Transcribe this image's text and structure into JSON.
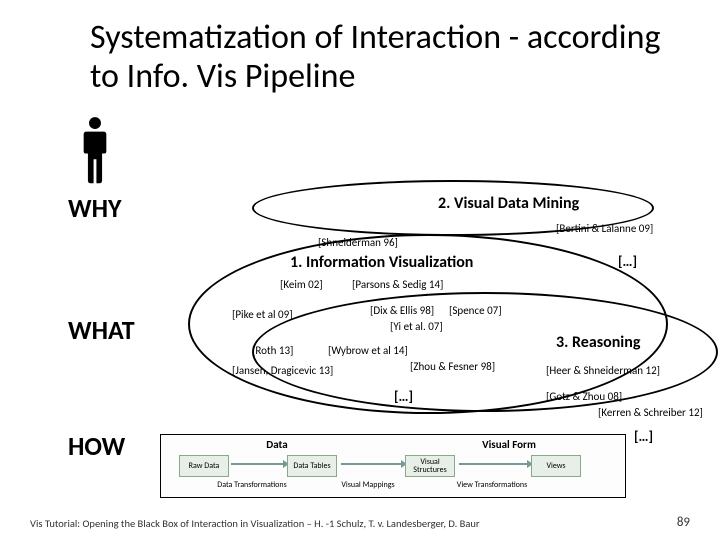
{
  "title": "Systematization of Interaction - according to Info. Vis Pipeline",
  "labels": {
    "why": "WHY",
    "what": "WHAT",
    "how": "HOW"
  },
  "headers": {
    "h1": "1. Information Visualization",
    "h2": "2. Visual Data Mining",
    "h3": "3. Reasoning"
  },
  "refs": {
    "shneiderman": "[Shneiderman 96]",
    "bertini": "[Bertini & Lalanne 09]",
    "keim": "[Keim 02]",
    "parsons": "[Parsons & Sedig 14]",
    "pike": "[Pike et al 09]",
    "dix": "[Dix & Ellis 98]",
    "spence": "[Spence 07]",
    "yi": "[Yi et al. 07]",
    "roth": "[Roth 13]",
    "wybrow": "[Wybrow et al 14]",
    "zhou": "[Zhou & Fesner 98]",
    "jansen": "[Jansen, Dragicevic 13]",
    "heer": "[Heer & Shneiderman 12]",
    "gotz": "[Gotz & Zhou 08]",
    "kerren": "[Kerren & Schreiber 12]",
    "dots": "[…]"
  },
  "pipeline": {
    "top": {
      "data": "Data",
      "form": "Visual Form"
    },
    "boxes": {
      "raw": "Raw Data",
      "tables": "Data Tables",
      "vs": "Visual Structures",
      "views": "Views"
    },
    "labels": {
      "dt": "Data Transformations",
      "vm": "Visual Mappings",
      "vt": "View Transformations"
    }
  },
  "footer": "Vis Tutorial: Opening the Black Box of Interaction in Visualization – H. -1 Schulz, T. v. Landesberger, D. Baur",
  "page": "89"
}
